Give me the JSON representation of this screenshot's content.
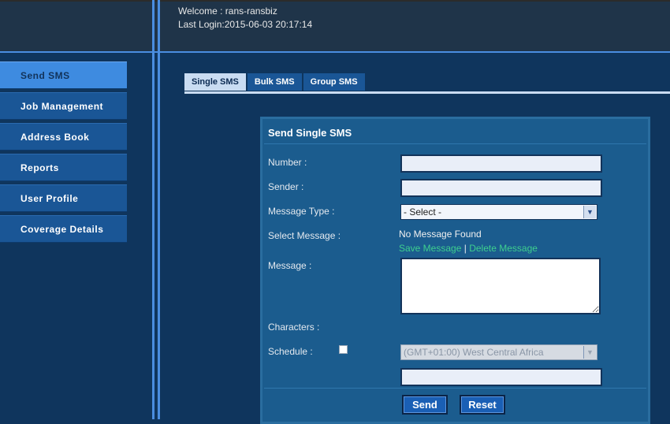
{
  "header": {
    "welcome": "Welcome : rans-ransbiz",
    "last_login": "Last Login:2015-06-03 20:17:14"
  },
  "sidebar": {
    "items": [
      {
        "label": "Send SMS",
        "active": true
      },
      {
        "label": "Job Management",
        "active": false
      },
      {
        "label": "Address Book",
        "active": false
      },
      {
        "label": "Reports",
        "active": false
      },
      {
        "label": "User Profile",
        "active": false
      },
      {
        "label": "Coverage Details",
        "active": false
      }
    ]
  },
  "tabs": [
    {
      "label": "Single SMS",
      "active": true
    },
    {
      "label": "Bulk SMS",
      "active": false
    },
    {
      "label": "Group SMS",
      "active": false
    }
  ],
  "form": {
    "title": "Send Single SMS",
    "number_label": "Number :",
    "number_value": "",
    "sender_label": "Sender :",
    "sender_value": "",
    "message_type_label": "Message Type :",
    "message_type_value": "- Select -",
    "select_message_label": "Select Message :",
    "no_message_text": "No Message Found",
    "save_message_link": "Save Message",
    "link_separator": "|",
    "delete_message_link": "Delete Message",
    "message_label": "Message :",
    "message_value": "",
    "characters_label": "Characters :",
    "schedule_label": "Schedule :",
    "schedule_checked": false,
    "timezone_value": "(GMT+01:00) West Central Africa",
    "schedule_time_value": "",
    "send_button": "Send",
    "reset_button": "Reset"
  },
  "colors": {
    "background": "#0f355d",
    "sidebar_item": "#1a5696",
    "sidebar_active": "#3e8be0",
    "accent_line": "#4a8de0",
    "link": "#3ecf8f"
  }
}
